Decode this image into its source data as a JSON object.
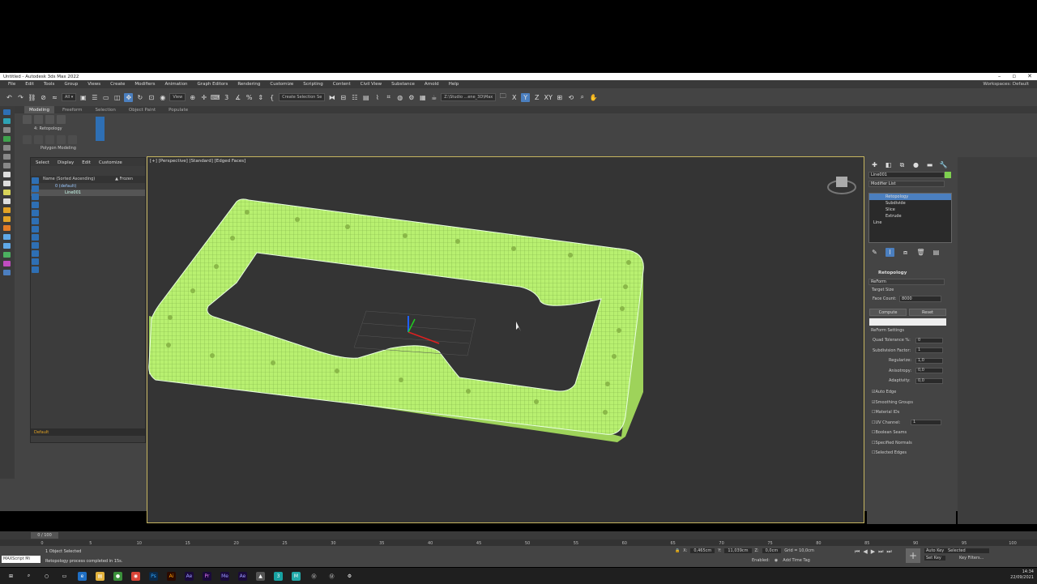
{
  "window": {
    "title": "Untitled - Autodesk 3ds Max 2022",
    "workspace_label": "Workspaces:",
    "workspace_value": "Default"
  },
  "menu": [
    "File",
    "Edit",
    "Tools",
    "Group",
    "Views",
    "Create",
    "Modifiers",
    "Animation",
    "Graph Editors",
    "Rendering",
    "Customize",
    "Scripting",
    "Content",
    "Civil View",
    "Substance",
    "Arnold",
    "Help"
  ],
  "toolbar": {
    "view_select": "View",
    "selection_set": "Create Selection Se",
    "path": "Z:\\Studio ...ene_3D\\Max"
  },
  "ribbon": {
    "tabs": [
      "Modeling",
      "Freeform",
      "Selection",
      "Object Paint",
      "Populate"
    ],
    "panel_label": "4: Retopology",
    "group_label": "Polygon Modeling"
  },
  "scene_explorer": {
    "tabs": [
      "Select",
      "Display",
      "Edit",
      "Customize"
    ],
    "col_name": "Name (Sorted Ascending)",
    "col_frozen": "▲ Frozen",
    "items": [
      "0 (default)",
      "Line001"
    ],
    "layer": "Default"
  },
  "viewport": {
    "label": "[+] [Perspective] [Standard] [Edged Faces]"
  },
  "command_panel": {
    "object_name": "Line001",
    "modifier_list": "Modifier List",
    "stack": [
      "Retopology",
      "Subdivide",
      "Slice",
      "Extrude",
      "Line"
    ],
    "rollout_title": "Retopology",
    "method": "ReForm",
    "target_size": "Target Size",
    "face_count_label": "Face Count:",
    "face_count": "8000",
    "compute": "Compute",
    "reset": "Reset",
    "reform_settings": "ReForm Settings",
    "params": [
      {
        "label": "Quad Tolerance %:",
        "value": "0"
      },
      {
        "label": "Subdivision Factor:",
        "value": "1"
      },
      {
        "label": "Regularize:",
        "value": "1,0"
      },
      {
        "label": "Anisotropy:",
        "value": "0,0"
      },
      {
        "label": "Adaptivity:",
        "value": "0,0"
      }
    ],
    "checks": [
      "Auto Edge",
      "Smoothing Groups",
      "Material IDs",
      "UV Channel:",
      "Boolean Seams",
      "Specified Normals",
      "Selected Edges"
    ],
    "uv_channel_value": "1"
  },
  "timeline": {
    "frame_counter": "0 / 100",
    "ticks": [
      "0",
      "5",
      "10",
      "15",
      "20",
      "25",
      "30",
      "35",
      "40",
      "45",
      "50",
      "55",
      "60",
      "65",
      "70",
      "75",
      "80",
      "85",
      "90",
      "95",
      "100"
    ]
  },
  "status": {
    "maxscript": "MAXScript Mi",
    "selected": "1 Object Selected",
    "prompt": "Retopology process completed in 15s.",
    "x": "0,465cm",
    "y": "11,039cm",
    "z": "0,0cm",
    "grid": "Grid = 10,0cm",
    "enabled": "Enabled:",
    "add_time_tag": "Add Time Tag",
    "auto_key": "Auto Key",
    "set_key": "Set Key",
    "selected_dd": "Selected",
    "key_filters": "Key Filters..."
  },
  "taskbar": {
    "time": "14:34",
    "date": "22/09/2021",
    "apps": [
      "Ai",
      "Ae",
      "Pr",
      "Me",
      "Ae"
    ]
  }
}
